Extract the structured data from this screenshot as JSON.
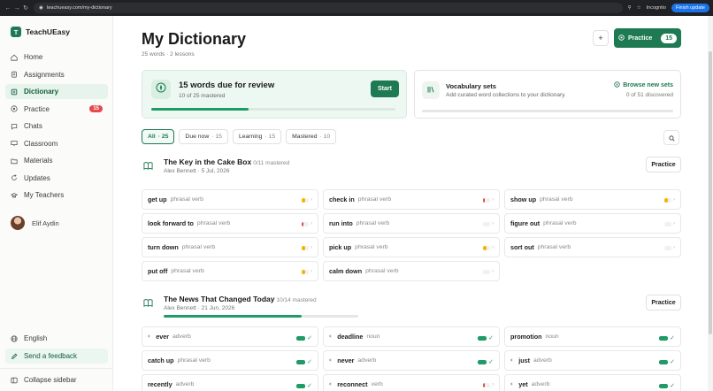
{
  "browser": {
    "url": "teachueasy.com/my-dictionary",
    "incognito_label": "Incognito",
    "finish_update_label": "Finish update"
  },
  "sidebar": {
    "brand_initial": "T",
    "brand": "TeachUEasy",
    "items": [
      {
        "label": "Home",
        "icon": "home-icon"
      },
      {
        "label": "Assignments",
        "icon": "clipboard-icon"
      },
      {
        "label": "Dictionary",
        "icon": "book-icon",
        "active": true
      },
      {
        "label": "Practice",
        "icon": "target-icon",
        "badge": "15"
      },
      {
        "label": "Chats",
        "icon": "chat-icon"
      },
      {
        "label": "Classroom",
        "icon": "classroom-icon"
      },
      {
        "label": "Materials",
        "icon": "folder-icon"
      },
      {
        "label": "Updates",
        "icon": "refresh-icon"
      },
      {
        "label": "My Teachers",
        "icon": "teacher-icon"
      }
    ],
    "profile_name": "Elif Aydin",
    "language": "English",
    "feedback": "Send a feedback",
    "collapse": "Collapse sidebar"
  },
  "header": {
    "title": "My Dictionary",
    "subtitle": "25 words · 2 lessons",
    "plus": "+",
    "practice_label": "Practice",
    "practice_count": "15"
  },
  "review": {
    "title": "15 words due for review",
    "subtitle": "10 of 25 mastered",
    "start_label": "Start",
    "progress": 0.4
  },
  "vocab": {
    "title": "Vocabulary sets",
    "subtitle": "Add curated word collections to your dictionary.",
    "browse_label": "Browse new sets",
    "discovered": "0 of 51 discovered"
  },
  "filters": [
    {
      "label": "All",
      "count": "· 25",
      "active": true
    },
    {
      "label": "Due now",
      "count": "· 15"
    },
    {
      "label": "Learning",
      "count": "· 15"
    },
    {
      "label": "Mastered",
      "count": "· 10"
    }
  ],
  "lessons": [
    {
      "title": "The Key in the Cake Box",
      "mastered": "0/11 mastered",
      "meta": "Alex Bennett · 5 Jul, 2026",
      "practice_label": "Practice",
      "progress": 0,
      "words": [
        {
          "word": "get up",
          "type": "phrasal verb",
          "status": "learning"
        },
        {
          "word": "check in",
          "type": "phrasal verb",
          "status": "new"
        },
        {
          "word": "show up",
          "type": "phrasal verb",
          "status": "learning"
        },
        {
          "word": "look forward to",
          "type": "phrasal verb",
          "status": "new"
        },
        {
          "word": "run into",
          "type": "phrasal verb",
          "status": "empty"
        },
        {
          "word": "figure out",
          "type": "phrasal verb",
          "status": "empty"
        },
        {
          "word": "turn down",
          "type": "phrasal verb",
          "status": "learning"
        },
        {
          "word": "pick up",
          "type": "phrasal verb",
          "status": "learning"
        },
        {
          "word": "sort out",
          "type": "phrasal verb",
          "status": "empty"
        },
        {
          "word": "put off",
          "type": "phrasal verb",
          "status": "learning"
        },
        {
          "word": "calm down",
          "type": "phrasal verb",
          "status": "empty"
        }
      ]
    },
    {
      "title": "The News That Changed Today",
      "mastered": "10/14 mastered",
      "meta": "Alex Bennett · 21 Jun, 2026",
      "practice_label": "Practice",
      "progress": 0.71,
      "words": [
        {
          "word": "ever",
          "type": "adverb",
          "status": "mastered",
          "speaker": true
        },
        {
          "word": "deadline",
          "type": "noun",
          "status": "mastered",
          "speaker": true
        },
        {
          "word": "promotion",
          "type": "noun",
          "status": "mastered"
        },
        {
          "word": "catch up",
          "type": "phrasal verb",
          "status": "mastered"
        },
        {
          "word": "never",
          "type": "adverb",
          "status": "mastered",
          "speaker": true
        },
        {
          "word": "just",
          "type": "adverb",
          "status": "mastered",
          "speaker": true
        },
        {
          "word": "recently",
          "type": "adverb",
          "status": "mastered"
        },
        {
          "word": "reconnect",
          "type": "verb",
          "status": "new",
          "speaker": true
        },
        {
          "word": "yet",
          "type": "adverb",
          "status": "mastered",
          "speaker": true
        }
      ]
    }
  ],
  "colors": {
    "accent": "#1e7a52",
    "learning": "#f5b400",
    "new": "#e5484d",
    "mastered": "#1e9b66"
  }
}
